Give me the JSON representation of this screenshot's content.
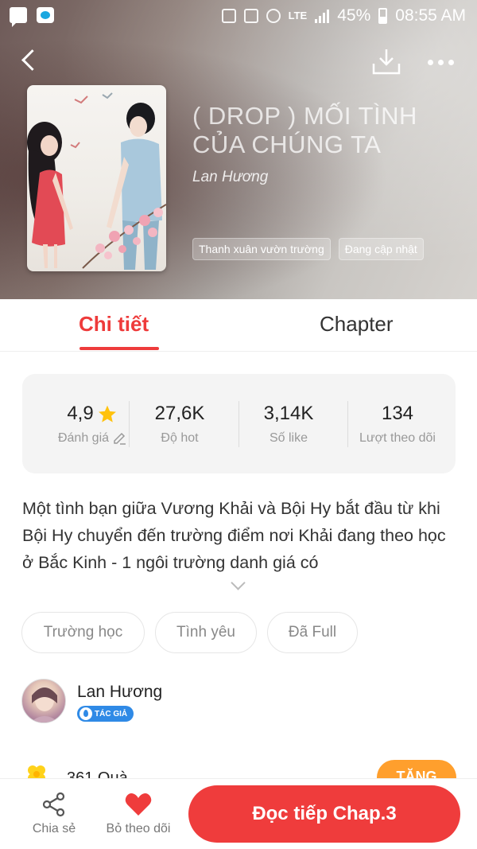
{
  "status_bar": {
    "battery": "45%",
    "time": "08:55 AM",
    "network": "LTE"
  },
  "book": {
    "title": "( DROP ) MỐI TÌNH CỦA CHÚNG TA",
    "author": "Lan Hương",
    "tags": [
      "Thanh xuân vườn trường",
      "Đang cập nhật"
    ]
  },
  "tabs": {
    "details": "Chi tiết",
    "chapter": "Chapter"
  },
  "stats": [
    {
      "value": "4,9",
      "label": "Đánh giá"
    },
    {
      "value": "27,6K",
      "label": "Độ hot"
    },
    {
      "value": "3,14K",
      "label": "Số like"
    },
    {
      "value": "134",
      "label": "Lượt theo dõi"
    }
  ],
  "description": "Một tình bạn giữa Vương Khải và Bội Hy bắt đầu từ khi Bội Hy chuyển đến trường điểm nơi Khải đang theo học ở Bắc Kinh - 1 ngôi trường danh giá có",
  "genres": [
    "Trường học",
    "Tình yêu",
    "Đã Full"
  ],
  "author_block": {
    "name": "Lan Hương",
    "badge": "TÁC GIẢ"
  },
  "gifts": {
    "text": "361 Quà",
    "button": "TẶNG"
  },
  "bottom_bar": {
    "share": "Chia sẻ",
    "unfollow": "Bỏ theo dõi",
    "continue": "Đọc tiếp Chap.3"
  },
  "colors": {
    "accent": "#ee3b3b",
    "star": "#ffc20e",
    "gift_button": "#ff9f2d",
    "badge": "#2f8ae6"
  }
}
